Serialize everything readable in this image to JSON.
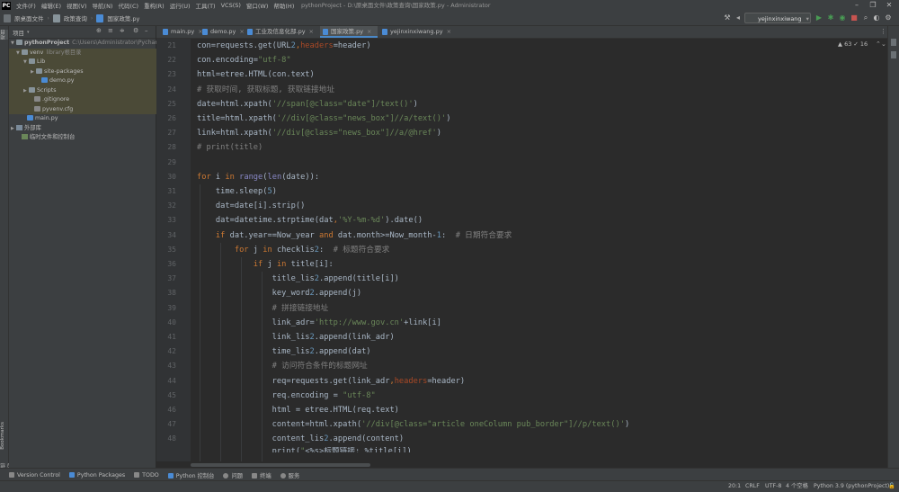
{
  "menubar": {
    "logo": "PC",
    "items": [
      "文件(F)",
      "编辑(E)",
      "视图(V)",
      "导航(N)",
      "代码(C)",
      "重构(R)",
      "运行(U)",
      "工具(T)",
      "VCS(S)",
      "窗口(W)",
      "帮助(H)"
    ],
    "window_title": "pythonProject - D:\\原桌面文件\\政策查询\\国家政策.py - Administrator"
  },
  "navbar": {
    "crumbs": [
      "原桌面文件",
      "政策查询",
      "国家政策.py"
    ]
  },
  "toolbar": {
    "run_config": "yejinxinxiwang"
  },
  "left_stripe": {
    "project_label": "项目",
    "bookmarks_label": "Bookmarks",
    "structure_label": "结构"
  },
  "project_panel": {
    "title": "项目",
    "root_name": "pythonProject",
    "root_path": "C:\\Users\\Administrator\\Pycharm",
    "venv_name": "venv",
    "venv_hint": "library根目录",
    "lib": "Lib",
    "site_packages": "site-packages",
    "demo": "demo.py",
    "scripts": "Scripts",
    "gitignore": ".gitignore",
    "pyvenv": "pyvenv.cfg",
    "main": "main.py",
    "external": "外部库",
    "scratches": "临时文件和控制台"
  },
  "tabs": [
    "main.py",
    "demo.py",
    "工业及信息化部.py",
    "国家政策.py",
    "yejinxinxiwang.py"
  ],
  "inspections": "▲ 63  ✓ 16",
  "line_numbers": [
    21,
    22,
    23,
    24,
    25,
    26,
    27,
    28,
    29,
    30,
    31,
    32,
    33,
    34,
    35,
    36,
    37,
    38,
    39,
    40,
    41,
    42,
    43,
    44,
    45,
    46,
    47,
    48
  ],
  "code": [
    "con=requests.get(URL2,headers=header)",
    "con.encoding=\"utf-8\"",
    "html=etree.HTML(con.text)",
    "# 获取时间, 获取标题, 获取链接地址",
    "date=html.xpath('//span[@class=\"date\"]/text()')",
    "title=html.xpath('//div[@class=\"news_box\"]//a/text()')",
    "link=html.xpath('//div[@class=\"news_box\"]//a/@href')",
    "# print(title)",
    "",
    "for i in range(len(date)):",
    "    time.sleep(5)",
    "    dat=date[i].strip()",
    "    dat=datetime.strptime(dat,'%Y-%m-%d').date()",
    "    if dat.year==Now_year and dat.month>=Now_month-1:  # 日期符合要求",
    "        for j in checklis2:  # 标题符合要求",
    "            if j in title[i]:",
    "                title_lis2.append(title[i])",
    "                key_word2.append(j)",
    "                # 拼接链接地址",
    "                link_adr='http://www.gov.cn'+link[i]",
    "                link_lis2.append(link_adr)",
    "                time_lis2.append(dat)",
    "                # 访问符合条件的标题网址",
    "                req=requests.get(link_adr,headers=header)",
    "                req.encoding = \"utf-8\"",
    "                html = etree.HTML(req.text)",
    "                content=html.xpath('//div[@class=\"article oneColumn pub_border\"]//p/text()')",
    "                content_lis2.append(content)"
  ],
  "code_partial": "                print(\"<%s>标题链接: %title[i])",
  "bottom_tools": [
    "Version Control",
    "Python Packages",
    "TODO",
    "Python 控制台",
    "问题",
    "终端",
    "服务"
  ],
  "status": {
    "position": "20:1",
    "line_sep": "CRLF",
    "encoding": "UTF-8",
    "indent": "4 个空格",
    "interpreter": "Python 3.9 (pythonProject)"
  }
}
